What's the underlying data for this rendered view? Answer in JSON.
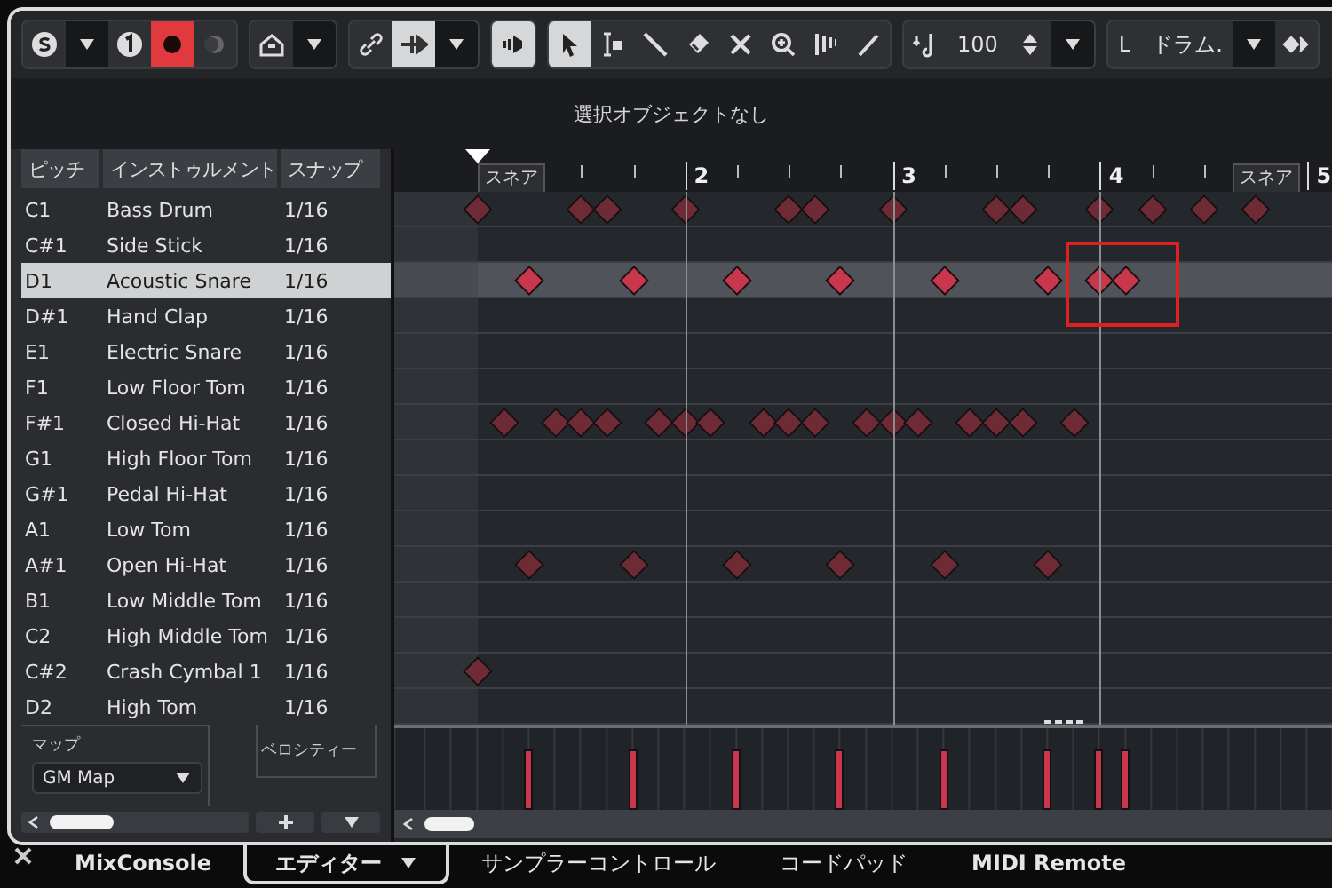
{
  "toolbar": [
    {
      "items": [
        {
          "kind": "solo",
          "active": false
        },
        {
          "kind": "caret",
          "active": false
        },
        {
          "kind": "one",
          "active": false
        },
        {
          "kind": "record",
          "active": true
        },
        {
          "kind": "moon",
          "active": false
        }
      ]
    },
    {
      "items": [
        {
          "kind": "house",
          "active": false
        },
        {
          "kind": "caret",
          "active": false
        }
      ]
    },
    {
      "items": [
        {
          "kind": "link",
          "active": false
        },
        {
          "kind": "split",
          "active": true
        },
        {
          "kind": "caret",
          "active": false
        }
      ]
    },
    {
      "items": [
        {
          "kind": "speaker",
          "active": true
        }
      ]
    },
    {
      "items": [
        {
          "kind": "pointer",
          "active": true
        },
        {
          "kind": "range",
          "active": false
        },
        {
          "kind": "draw",
          "active": false
        },
        {
          "kind": "eraser",
          "active": false
        },
        {
          "kind": "mute",
          "active": false
        },
        {
          "kind": "zoom",
          "active": false
        },
        {
          "kind": "comb",
          "active": false
        },
        {
          "kind": "line",
          "active": false
        }
      ]
    },
    {
      "items": [
        {
          "kind": "quantize",
          "active": false
        },
        {
          "kind": "text",
          "text": "100"
        },
        {
          "kind": "spinner",
          "active": false
        },
        {
          "kind": "caret",
          "active": false
        }
      ]
    },
    {
      "items": [
        {
          "kind": "text",
          "text": "L"
        },
        {
          "kind": "text",
          "text": "ドラム."
        },
        {
          "kind": "caret"
        },
        {
          "kind": "diamonds"
        }
      ]
    }
  ],
  "info": "選択オブジェクトなし",
  "columns": [
    "ピッチ",
    "インストゥルメント",
    "スナップ"
  ],
  "ruler": {
    "bars": [
      "2",
      "3",
      "4",
      "5"
    ],
    "markers": [
      "スネア",
      "スネア"
    ]
  },
  "rows": [
    {
      "pitch": "C1",
      "instrument": "Bass Drum",
      "snap": "1/16",
      "selected": false,
      "hits": [
        true,
        false,
        false,
        false,
        false,
        false,
        false,
        false,
        true,
        false,
        true,
        false,
        false,
        false,
        false,
        false,
        true,
        false,
        false,
        false,
        false,
        false,
        false,
        false,
        true,
        false,
        true,
        false,
        false,
        false,
        false,
        false,
        true,
        false,
        false,
        false,
        false,
        false,
        false,
        false,
        true,
        false,
        true,
        false,
        false,
        false,
        false,
        false,
        true,
        false,
        false,
        false,
        true,
        false,
        false,
        false,
        true,
        false,
        false,
        false,
        true,
        false,
        false,
        false
      ]
    },
    {
      "pitch": "C#1",
      "instrument": "Side Stick",
      "snap": "1/16",
      "selected": false,
      "hits": []
    },
    {
      "pitch": "D1",
      "instrument": "Acoustic Snare",
      "snap": "1/16",
      "selected": true,
      "hits": [
        false,
        false,
        false,
        false,
        true,
        false,
        false,
        false,
        false,
        false,
        false,
        false,
        true,
        false,
        false,
        false,
        false,
        false,
        false,
        false,
        true,
        false,
        false,
        false,
        false,
        false,
        false,
        false,
        true,
        false,
        false,
        false,
        false,
        false,
        false,
        false,
        true,
        false,
        false,
        false,
        false,
        false,
        false,
        false,
        true,
        false,
        false,
        false,
        true,
        false,
        true,
        false,
        false,
        false,
        false,
        false,
        false,
        false,
        false,
        false,
        false,
        false,
        false,
        false
      ]
    },
    {
      "pitch": "D#1",
      "instrument": "Hand Clap",
      "snap": "1/16",
      "selected": false,
      "hits": []
    },
    {
      "pitch": "E1",
      "instrument": "Electric Snare",
      "snap": "1/16",
      "selected": false,
      "hits": []
    },
    {
      "pitch": "F1",
      "instrument": "Low Floor Tom",
      "snap": "1/16",
      "selected": false,
      "hits": []
    },
    {
      "pitch": "F#1",
      "instrument": "Closed Hi-Hat",
      "snap": "1/16",
      "selected": false,
      "hits": [
        false,
        false,
        true,
        false,
        false,
        false,
        true,
        false,
        true,
        false,
        true,
        false,
        false,
        false,
        true,
        false,
        true,
        false,
        true,
        false,
        false,
        false,
        true,
        false,
        true,
        false,
        true,
        false,
        false,
        false,
        true,
        false,
        true,
        false,
        true,
        false,
        false,
        false,
        true,
        false,
        true,
        false,
        true,
        false,
        false,
        false,
        true,
        false,
        false,
        false,
        false,
        false,
        false,
        false,
        false,
        false,
        false,
        false,
        false,
        false,
        false,
        false,
        false,
        false
      ]
    },
    {
      "pitch": "G1",
      "instrument": "High Floor Tom",
      "snap": "1/16",
      "selected": false,
      "hits": []
    },
    {
      "pitch": "G#1",
      "instrument": "Pedal Hi-Hat",
      "snap": "1/16",
      "selected": false,
      "hits": []
    },
    {
      "pitch": "A1",
      "instrument": "Low Tom",
      "snap": "1/16",
      "selected": false,
      "hits": []
    },
    {
      "pitch": "A#1",
      "instrument": "Open Hi-Hat",
      "snap": "1/16",
      "selected": false,
      "hits": [
        false,
        false,
        false,
        false,
        true,
        false,
        false,
        false,
        false,
        false,
        false,
        false,
        true,
        false,
        false,
        false,
        false,
        false,
        false,
        false,
        true,
        false,
        false,
        false,
        false,
        false,
        false,
        false,
        true,
        false,
        false,
        false,
        false,
        false,
        false,
        false,
        true,
        false,
        false,
        false,
        false,
        false,
        false,
        false,
        true,
        false,
        false,
        false,
        false,
        false,
        false,
        false,
        false,
        false,
        false,
        false,
        false,
        false,
        false,
        false,
        false,
        false,
        false,
        false
      ]
    },
    {
      "pitch": "B1",
      "instrument": "Low Middle Tom",
      "snap": "1/16",
      "selected": false,
      "hits": []
    },
    {
      "pitch": "C2",
      "instrument": "High Middle Tom",
      "snap": "1/16",
      "selected": false,
      "hits": []
    },
    {
      "pitch": "C#2",
      "instrument": "Crash Cymbal 1",
      "snap": "1/16",
      "selected": false,
      "hits": [
        true,
        false,
        false,
        false,
        false,
        false,
        false,
        false,
        false,
        false,
        false,
        false,
        false,
        false,
        false,
        false,
        false,
        false,
        false,
        false,
        false,
        false,
        false,
        false,
        false,
        false,
        false,
        false,
        false,
        false,
        false,
        false,
        false,
        false,
        false,
        false,
        false,
        false,
        false,
        false,
        false,
        false,
        false,
        false,
        false,
        false,
        false,
        false,
        false,
        false,
        false,
        false,
        false,
        false,
        false,
        false,
        false,
        false,
        false,
        false,
        false,
        false,
        false,
        false
      ]
    },
    {
      "pitch": "D2",
      "instrument": "High Tom",
      "snap": "1/16",
      "selected": false,
      "hits": []
    }
  ],
  "map": {
    "label": "マップ",
    "value": "GM Map"
  },
  "velocity_label": "ベロシティー",
  "tabs": [
    {
      "label": "MixConsole",
      "selected": false
    },
    {
      "label": "エディター",
      "selected": true
    },
    {
      "label": "サンプラーコントロール",
      "selected": false
    },
    {
      "label": "コードパッド",
      "selected": false
    },
    {
      "label": "MIDI Remote",
      "selected": false
    }
  ]
}
